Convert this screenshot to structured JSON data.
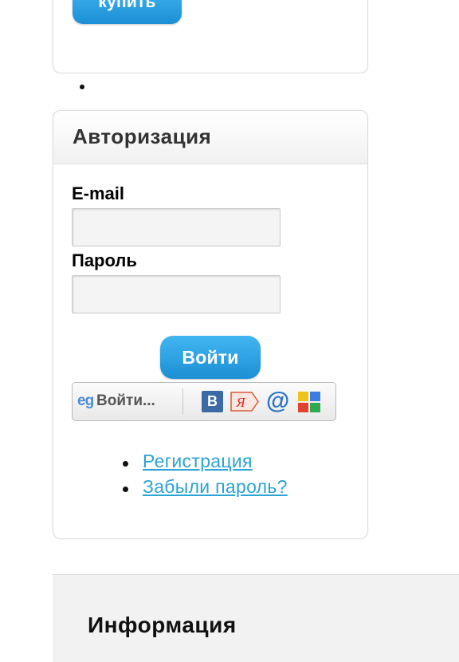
{
  "buy_panel": {
    "buy_label": "купить"
  },
  "auth": {
    "title": "Авторизация",
    "email_label": "E-mail",
    "email_value": "",
    "password_label": "Пароль",
    "password_value": "",
    "login_label": "Войти",
    "social": {
      "login_label": "Войти...",
      "providers": [
        "loginza-icon",
        "vkontakte-icon",
        "yandex-icon",
        "mailru-icon",
        "google-icon"
      ],
      "vk_letter": "B",
      "yandex_letter": "Я"
    },
    "links": [
      "Регистрация",
      "Забыли пароль?"
    ],
    "colors": {
      "button": "#1c8fd6",
      "link": "#2aa3d6"
    }
  },
  "info": {
    "title": "Информация"
  }
}
